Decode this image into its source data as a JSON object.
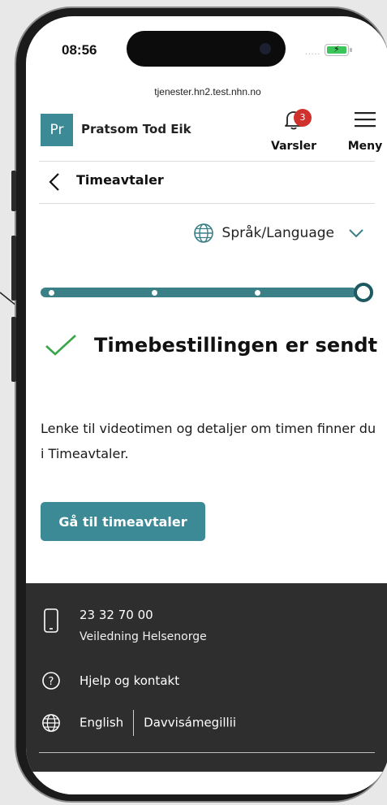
{
  "status_bar": {
    "time": "08:56",
    "signal": "....."
  },
  "browser": {
    "url": "tjenester.hn2.test.nhn.no"
  },
  "header": {
    "avatar_initials": "Pr",
    "user_name": "Pratsom Tod Eik",
    "notifications_label": "Varsler",
    "notifications_count": "3",
    "menu_label": "Meny"
  },
  "nav": {
    "back_title": "Timeavtaler"
  },
  "language": {
    "label": "Språk/Language"
  },
  "progress": {
    "current_step": 4,
    "total_steps": 4
  },
  "main": {
    "success_title": "Timebestillingen er sendt",
    "description": "Lenke til videotimen og detaljer om timen finner du i Timeavtaler.",
    "cta_label": "Gå til timeavtaler"
  },
  "footer": {
    "phone_number": "23 32 70 00",
    "phone_caption": "Veiledning Helsenorge",
    "help_label": "Hjelp og kontakt",
    "lang_english": "English",
    "lang_sami": "Davvisámegillii"
  },
  "colors": {
    "accent": "#3b8a96",
    "progress_track": "#3b7f87",
    "check_green": "#3aa64a",
    "badge_red": "#d0312d",
    "footer_bg": "#2e2e2e"
  }
}
